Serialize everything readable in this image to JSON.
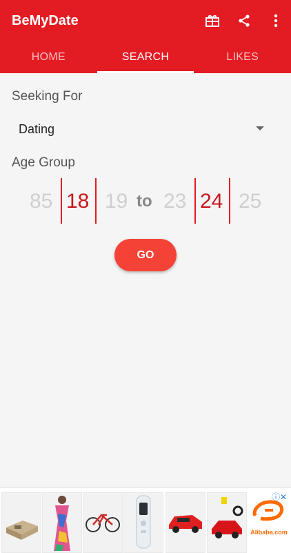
{
  "app": {
    "title": "BeMyDate",
    "accent": "#e31b23",
    "actions": [
      "gift-icon",
      "share-icon",
      "more-vert-icon"
    ]
  },
  "tabs": [
    {
      "label": "HOME",
      "active": false
    },
    {
      "label": "SEARCH",
      "active": true
    },
    {
      "label": "LIKES",
      "active": false
    }
  ],
  "search": {
    "seeking_label": "Seeking For",
    "seeking_value": "Dating",
    "age_label": "Age Group",
    "min_prev": "85",
    "min_selected": "18",
    "min_next": "19",
    "to_label": "to",
    "max_prev": "23",
    "max_selected": "24",
    "max_next": "25",
    "go_label": "GO"
  },
  "ad": {
    "brand": "Alibaba.com",
    "info_icon": "info-close-icon"
  }
}
